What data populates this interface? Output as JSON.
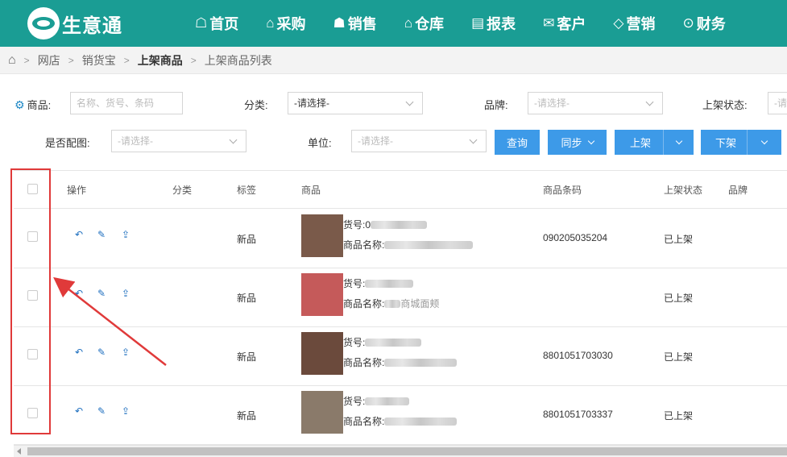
{
  "app": {
    "logo_text": "生意通"
  },
  "nav": [
    {
      "icon": "home-outline-icon",
      "glyph": "☖",
      "label": "首页"
    },
    {
      "icon": "shop-icon",
      "glyph": "⌂",
      "label": "采购"
    },
    {
      "icon": "people-icon",
      "glyph": "☗",
      "label": "销售"
    },
    {
      "icon": "warehouse-icon",
      "glyph": "⌂",
      "label": "仓库"
    },
    {
      "icon": "report-icon",
      "glyph": "▤",
      "label": "报表"
    },
    {
      "icon": "mail-icon",
      "glyph": "✉",
      "label": "客户"
    },
    {
      "icon": "tag-icon",
      "glyph": "◇",
      "label": "营销"
    },
    {
      "icon": "finance-icon",
      "glyph": "⊙",
      "label": "财务"
    }
  ],
  "breadcrumb": {
    "home_icon": "⌂",
    "items": [
      "网店",
      "销货宝",
      "上架商品",
      "上架商品列表"
    ]
  },
  "filters": {
    "product_label": "商品:",
    "product_placeholder": "名称、货号、条码",
    "category_label": "分类:",
    "category_value": "-请选择-",
    "brand_label": "品牌:",
    "brand_value": "-请选择-",
    "shelf_status_label": "上架状态:",
    "shelf_status_value": "-请",
    "has_image_label": "是否配图:",
    "has_image_value": "-请选择-",
    "unit_label": "单位:",
    "unit_value": "-请选择-"
  },
  "buttons": {
    "query": "查询",
    "sync": "同步",
    "shelve": "上架",
    "unshelve": "下架"
  },
  "table": {
    "headers": {
      "action": "操作",
      "category": "分类",
      "tag": "标签",
      "product": "商品",
      "barcode": "商品条码",
      "status": "上架状态",
      "brand": "品牌"
    },
    "code_label": "货号:",
    "name_label": "商品名称:",
    "rows": [
      {
        "tag": "新品",
        "code_visible": "0",
        "name_visible": "",
        "barcode": "090205035204",
        "status": "已上架",
        "thumb": "#7a5a4a"
      },
      {
        "tag": "新品",
        "code_visible": "",
        "name_visible": "商城面颊",
        "barcode": "",
        "status": "已上架",
        "thumb": "#c55a5a"
      },
      {
        "tag": "新品",
        "code_visible": "",
        "name_visible": "",
        "barcode": "8801051703030",
        "status": "已上架",
        "thumb": "#6b4a3c"
      },
      {
        "tag": "新品",
        "code_visible": "",
        "name_visible": "",
        "barcode": "8801051703337",
        "status": "已上架",
        "thumb": "#8a7a6a"
      }
    ]
  },
  "colors": {
    "brand": "#1a9d94",
    "button": "#3d9ae8",
    "annotation": "#e03a3a"
  }
}
